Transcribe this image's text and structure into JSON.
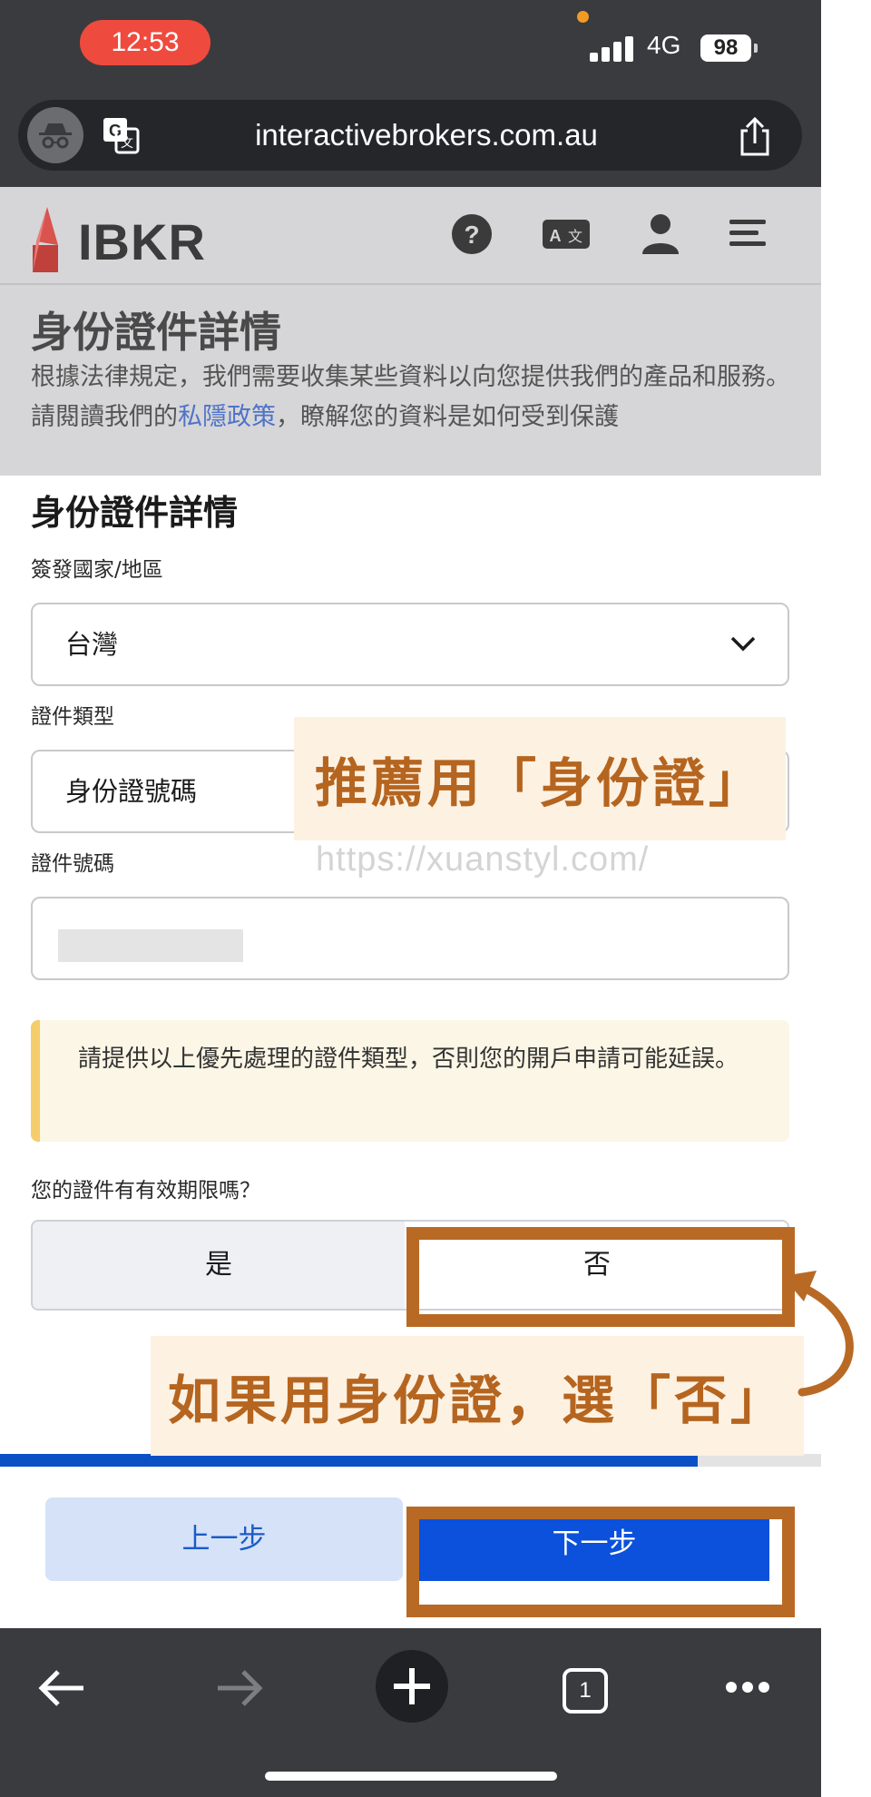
{
  "status_bar": {
    "time": "12:53",
    "network": "4G",
    "battery": "98"
  },
  "browser": {
    "url": "interactivebrokers.com.au"
  },
  "site": {
    "brand": "IBKR"
  },
  "background_section": {
    "title": "身份證件詳情",
    "desc_part1": "根據法律規定，我們需要收集某些資料以向您提供我們的產品和服務。請閱讀我們的",
    "privacy_link": "私隱政策",
    "desc_part2": "，瞭解您的資料是如何受到保護"
  },
  "form": {
    "title": "身份證件詳情",
    "country_label": "簽發國家/地區",
    "country_value": "台灣",
    "doc_type_label": "證件類型",
    "doc_type_value": "身份證號碼",
    "doc_number_label": "證件號碼",
    "notice": "請提供以上優先處理的證件類型，否則您的開戶申請可能延誤。",
    "expiry_question": "您的證件有有效期限嗎？",
    "yes_label": "是",
    "no_label": "否",
    "progress": 0.85,
    "prev_label": "上一步",
    "next_label": "下一步"
  },
  "annotations": {
    "note1": "推薦用「身份證」",
    "note2": "如果用身份證，選「否」",
    "watermark": "https://xuanstyl.com/"
  },
  "toolbar": {
    "tab_count": "1"
  },
  "colors": {
    "accent_blue": "#0b51db",
    "annotation_orange": "#b86a25",
    "notice_bg": "#fcf6e6",
    "notice_border": "#f5cd6a",
    "status_time_red": "#ef4a3e"
  }
}
